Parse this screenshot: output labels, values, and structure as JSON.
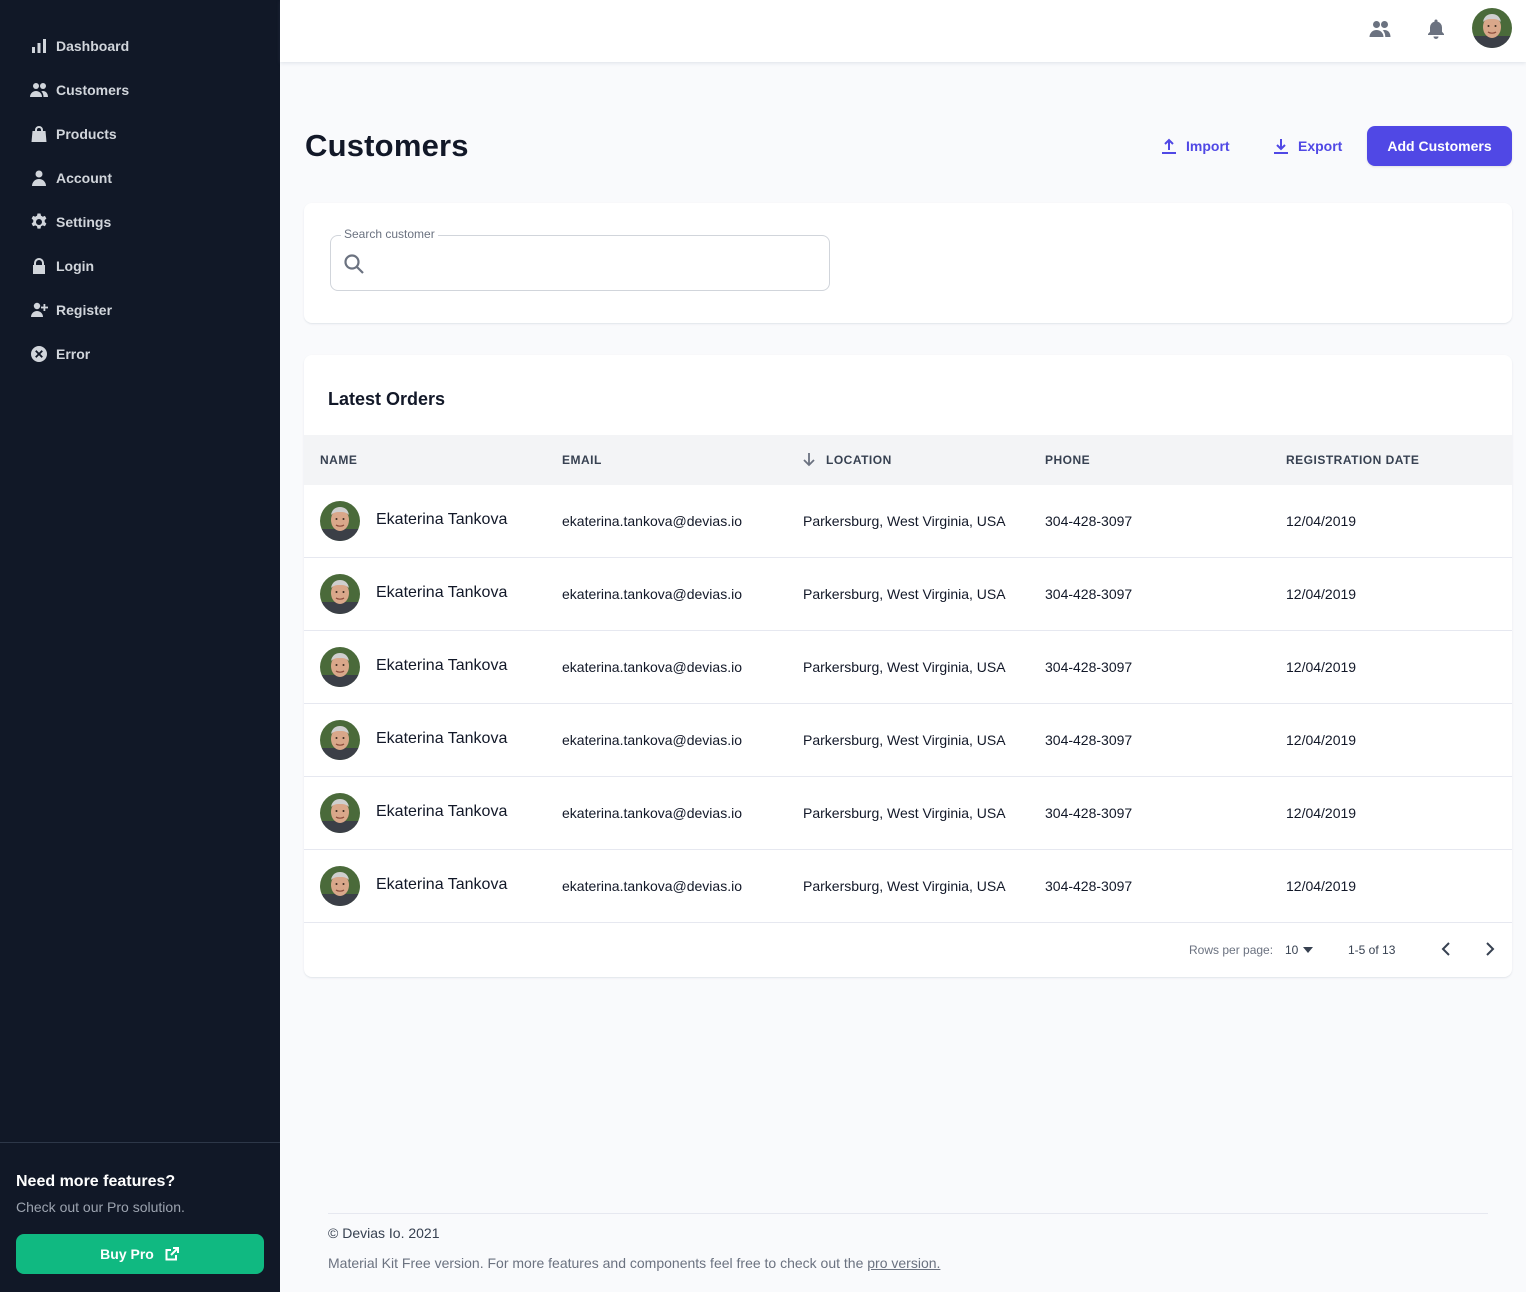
{
  "sidebar": {
    "items": [
      {
        "label": "Dashboard",
        "icon": "chart-bar-icon"
      },
      {
        "label": "Customers",
        "icon": "users-icon"
      },
      {
        "label": "Products",
        "icon": "shopping-bag-icon"
      },
      {
        "label": "Account",
        "icon": "user-icon"
      },
      {
        "label": "Settings",
        "icon": "cog-icon"
      },
      {
        "label": "Login",
        "icon": "lock-icon"
      },
      {
        "label": "Register",
        "icon": "user-add-icon"
      },
      {
        "label": "Error",
        "icon": "x-circle-icon"
      }
    ],
    "promo": {
      "title": "Need more features?",
      "subtitle": "Check out our Pro solution.",
      "button_label": "Buy Pro"
    }
  },
  "topbar": {
    "icons": [
      "users-icon",
      "bell-icon"
    ]
  },
  "page": {
    "title": "Customers",
    "import_label": "Import",
    "export_label": "Export",
    "add_label": "Add Customers"
  },
  "search": {
    "label": "Search customer",
    "value": ""
  },
  "table": {
    "title": "Latest Orders",
    "columns": [
      "Name",
      "Email",
      "Location",
      "Phone",
      "Registration date"
    ],
    "rows": [
      {
        "name": "Ekaterina Tankova",
        "email": "ekaterina.tankova@devias.io",
        "location": "Parkersburg, West Virginia, USA",
        "phone": "304-428-3097",
        "date": "12/04/2019"
      },
      {
        "name": "Ekaterina Tankova",
        "email": "ekaterina.tankova@devias.io",
        "location": "Parkersburg, West Virginia, USA",
        "phone": "304-428-3097",
        "date": "12/04/2019"
      },
      {
        "name": "Ekaterina Tankova",
        "email": "ekaterina.tankova@devias.io",
        "location": "Parkersburg, West Virginia, USA",
        "phone": "304-428-3097",
        "date": "12/04/2019"
      },
      {
        "name": "Ekaterina Tankova",
        "email": "ekaterina.tankova@devias.io",
        "location": "Parkersburg, West Virginia, USA",
        "phone": "304-428-3097",
        "date": "12/04/2019"
      },
      {
        "name": "Ekaterina Tankova",
        "email": "ekaterina.tankova@devias.io",
        "location": "Parkersburg, West Virginia, USA",
        "phone": "304-428-3097",
        "date": "12/04/2019"
      },
      {
        "name": "Ekaterina Tankova",
        "email": "ekaterina.tankova@devias.io",
        "location": "Parkersburg, West Virginia, USA",
        "phone": "304-428-3097",
        "date": "12/04/2019"
      }
    ],
    "pagination": {
      "rows_per_page_label": "Rows per page:",
      "rows_per_page": "10",
      "range": "1-5 of 13"
    }
  },
  "footer": {
    "copyright": "© Devias Io. 2021",
    "note": "Material Kit Free version. For more features and components feel free to check out the ",
    "link_label": "pro version."
  },
  "colors": {
    "sidebar_bg": "#111827",
    "primary": "#5048e5",
    "success": "#10b981",
    "page_bg": "#f9fafc"
  }
}
